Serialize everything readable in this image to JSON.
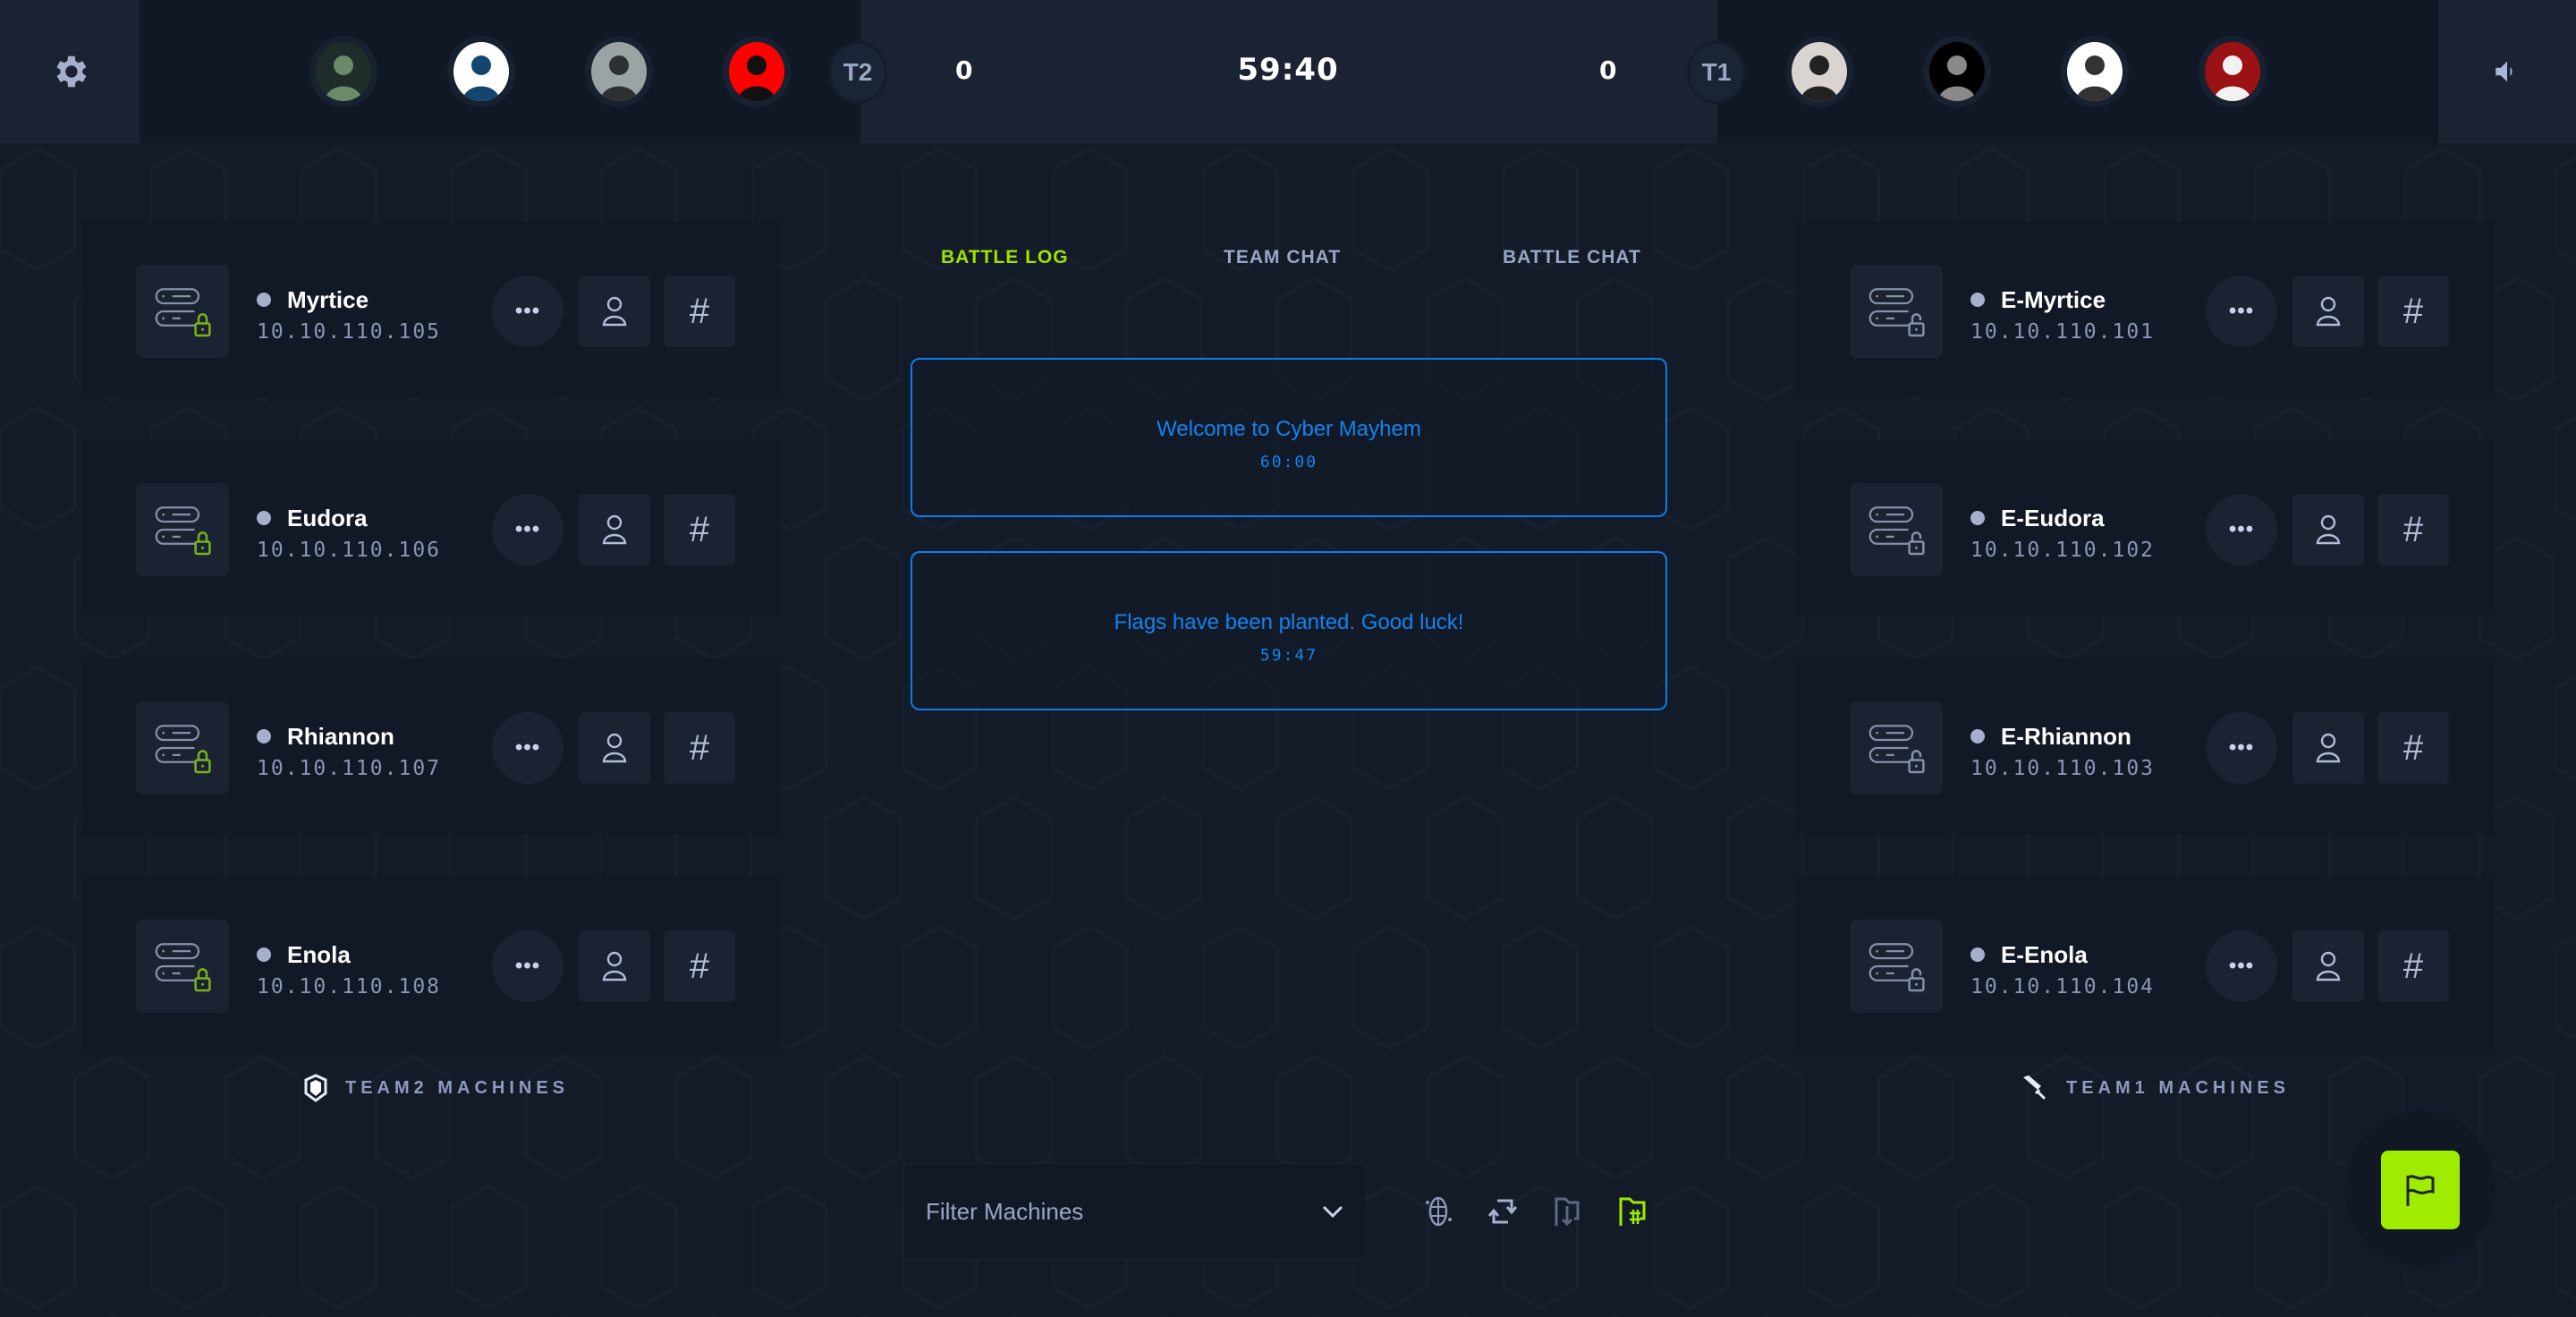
{
  "header": {
    "settings_icon": "gear-icon",
    "volume_icon": "speaker-icon",
    "team_left": {
      "badge": "T2",
      "score": "0",
      "avatars": [
        {
          "name": "plague-doctor-avatar",
          "bg": "#1e2c2a",
          "fg": "#6a8a6a"
        },
        {
          "name": "pixel-tower-avatar",
          "bg": "#ffffff",
          "fg": "#13466e"
        },
        {
          "name": "grayscale-portrait-avatar",
          "bg": "#9ca3a4",
          "fg": "#2d3131"
        },
        {
          "name": "ninja-avatar",
          "bg": "#ff0000",
          "fg": "#111111"
        }
      ]
    },
    "timer": "59:40",
    "team_right": {
      "badge": "T1",
      "score": "0",
      "avatars": [
        {
          "name": "masked-girl-avatar",
          "bg": "#d9d4d0",
          "fg": "#222222"
        },
        {
          "name": "dark-figure-avatar",
          "bg": "#000000",
          "fg": "#8a8a8a"
        },
        {
          "name": "penguin-avatar",
          "bg": "#ffffff",
          "fg": "#333333"
        },
        {
          "name": "umbrella-logo-avatar",
          "bg": "#9b1214",
          "fg": "#f2f2f2"
        }
      ]
    }
  },
  "team2": {
    "label": "TEAM2 MACHINES",
    "icon": "shield-icon",
    "machines": [
      {
        "name": "Myrtice",
        "ip": "10.10.110.105",
        "lock": "locked"
      },
      {
        "name": "Eudora",
        "ip": "10.10.110.106",
        "lock": "locked"
      },
      {
        "name": "Rhiannon",
        "ip": "10.10.110.107",
        "lock": "locked"
      },
      {
        "name": "Enola",
        "ip": "10.10.110.108",
        "lock": "locked"
      }
    ]
  },
  "team1": {
    "label": "TEAM1 MACHINES",
    "icon": "sword-icon",
    "machines": [
      {
        "name": "E-Myrtice",
        "ip": "10.10.110.101",
        "lock": "unlocked"
      },
      {
        "name": "E-Eudora",
        "ip": "10.10.110.102",
        "lock": "unlocked"
      },
      {
        "name": "E-Rhiannon",
        "ip": "10.10.110.103",
        "lock": "unlocked"
      },
      {
        "name": "E-Enola",
        "ip": "10.10.110.104",
        "lock": "unlocked"
      }
    ]
  },
  "card_buttons": {
    "more": "•••",
    "hash": "#"
  },
  "center": {
    "tabs": [
      {
        "label": "BATTLE LOG",
        "active": true
      },
      {
        "label": "TEAM CHAT",
        "active": false
      },
      {
        "label": "BATTLE CHAT",
        "active": false
      }
    ],
    "log": [
      {
        "message": "Welcome to Cyber Mayhem",
        "time": "60:00"
      },
      {
        "message": "Flags have been planted. Good luck!",
        "time": "59:47"
      }
    ]
  },
  "bottom": {
    "filter_label": "Filter Machines",
    "tools": [
      "network-globe-icon",
      "swap-refresh-icon",
      "flag-download-icon",
      "flag-hash-icon"
    ]
  },
  "colors": {
    "accent_green": "#9fec00",
    "log_blue": "#1184f0",
    "background": "#131b29"
  }
}
